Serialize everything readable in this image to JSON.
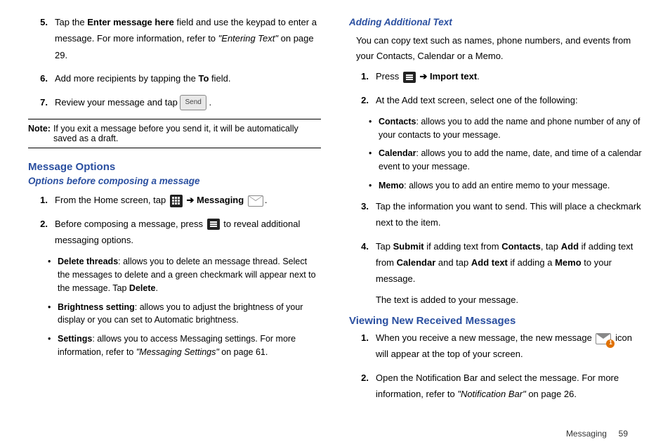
{
  "left": {
    "step5_a": "Tap the ",
    "step5_b": "Enter message here",
    "step5_c": " field and use the keypad to enter a message. For more information, refer to ",
    "step5_d": "\"Entering Text\"",
    "step5_e": "  on page 29.",
    "step6_a": "Add more recipients by tapping the ",
    "step6_b": "To",
    "step6_c": " field.",
    "step7_a": "Review your message and tap ",
    "send_label": "Send",
    "step7_b": ".",
    "note_label": "Note:",
    "note_body": "If you exit a message before you send it, it will be automatically saved as a draft.",
    "h1": "Message Options",
    "h2": "Options before composing a message",
    "opt1_a": "From the Home screen, tap ",
    "opt1_b": "Messaging",
    "opt1_c": ".",
    "opt2_a": "Before composing a message, press ",
    "opt2_b": " to reveal additional messaging options.",
    "b1_a": "Delete threads",
    "b1_b": ": allows you to delete an message thread. Select the messages to delete and a green checkmark will appear next to the message. Tap ",
    "b1_c": "Delete",
    "b1_d": ".",
    "b2_a": "Brightness setting",
    "b2_b": ": allows you to adjust the brightness of your display or you can set to Automatic brightness.",
    "b3_a": "Settings",
    "b3_b": ": allows you to access Messaging settings. For more information, refer to ",
    "b3_c": "\"Messaging Settings\"",
    "b3_d": "  on page 61."
  },
  "right": {
    "h2a": "Adding Additional Text",
    "intro": "You can copy text such as names, phone numbers, and events from your Contacts, Calendar or a Memo.",
    "s1_a": "Press ",
    "s1_b": "Import text",
    "s1_c": ".",
    "s2": "At the Add text screen, select one of the following:",
    "rb1_a": "Contacts",
    "rb1_b": ": allows you to add the name and phone number of any of your contacts to your message.",
    "rb2_a": "Calendar",
    "rb2_b": ": allows you to add the name, date, and time of a calendar event to your message.",
    "rb3_a": "Memo",
    "rb3_b": ": allows you to add an entire memo to your message.",
    "s3": "Tap the information you want to send. This will place a checkmark next to the item.",
    "s4_a": "Tap ",
    "s4_b": "Submit",
    "s4_c": " if adding text from ",
    "s4_d": "Contacts",
    "s4_e": ", tap ",
    "s4_f": "Add",
    "s4_g": " if adding text from ",
    "s4_h": "Calendar",
    "s4_i": " and tap ",
    "s4_j": "Add text",
    "s4_k": " if adding a ",
    "s4_l": "Memo",
    "s4_m": " to your message.",
    "s4_sub": "The text is added to your message.",
    "h1b": "Viewing New Received Messages",
    "v1_a": "When you receive a new message, the new message ",
    "v1_b": " icon will appear at the top of your screen.",
    "v2_a": "Open the Notification Bar and select the message. For more information, refer to ",
    "v2_b": "\"Notification Bar\"",
    "v2_c": "  on page 26."
  },
  "footer_section": "Messaging",
  "footer_page": "59",
  "arrow": "➔"
}
